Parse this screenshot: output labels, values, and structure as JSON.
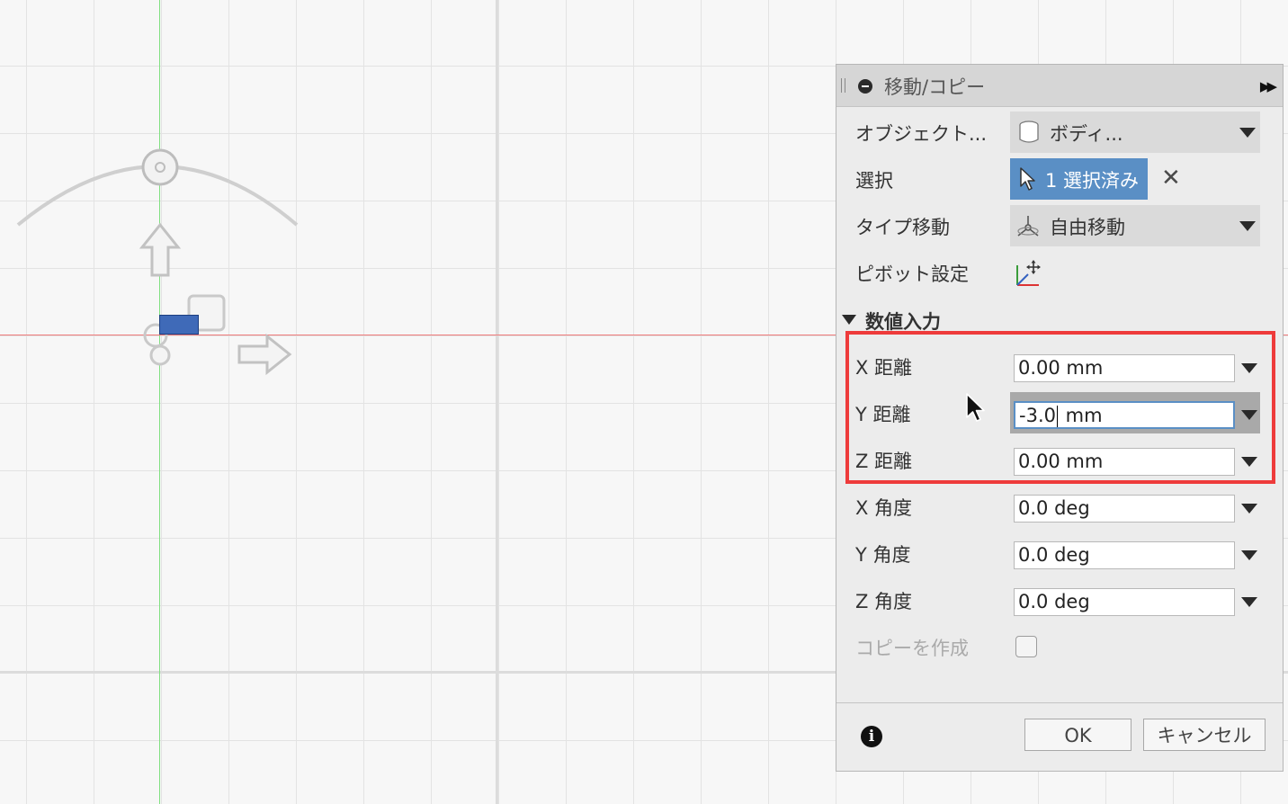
{
  "dialog": {
    "title": "移動/コピー",
    "rows": {
      "object": {
        "label": "オブジェクト...",
        "value": "ボディ..."
      },
      "selection": {
        "label": "選択",
        "value": "1 選択済み"
      },
      "move_type": {
        "label": "タイプ移動",
        "value": "自由移動"
      },
      "pivot": {
        "label": "ピボット設定"
      }
    },
    "section": {
      "label": "数値入力",
      "expanded": true
    },
    "fields": {
      "x_distance": {
        "label": "X 距離",
        "value": "0.00 mm"
      },
      "y_distance": {
        "label": "Y 距離",
        "value_before_caret": "-3.0",
        "value_after_caret": " mm"
      },
      "z_distance": {
        "label": "Z 距離",
        "value": "0.00 mm"
      },
      "x_angle": {
        "label": "X 角度",
        "value": "0.0 deg"
      },
      "y_angle": {
        "label": "Y 角度",
        "value": "0.0 deg"
      },
      "z_angle": {
        "label": "Z 角度",
        "value": "0.0 deg"
      }
    },
    "create_copy": {
      "label": "コピーを作成",
      "checked": false,
      "enabled": false
    },
    "buttons": {
      "ok": "OK",
      "cancel": "キャンセル"
    }
  },
  "colors": {
    "selection_button": "#5a8fc5",
    "highlight_box": "#ee3b3b",
    "y_axis": "#7fe07f",
    "x_axis": "#ef7a7a",
    "selected_body": "#3f6ab8"
  },
  "icons": [
    "collapse-icon",
    "expand-icon",
    "body-icon",
    "cursor-select-icon",
    "close-icon",
    "free-move-icon",
    "pivot-icon",
    "info-icon",
    "mouse-cursor-icon"
  ]
}
